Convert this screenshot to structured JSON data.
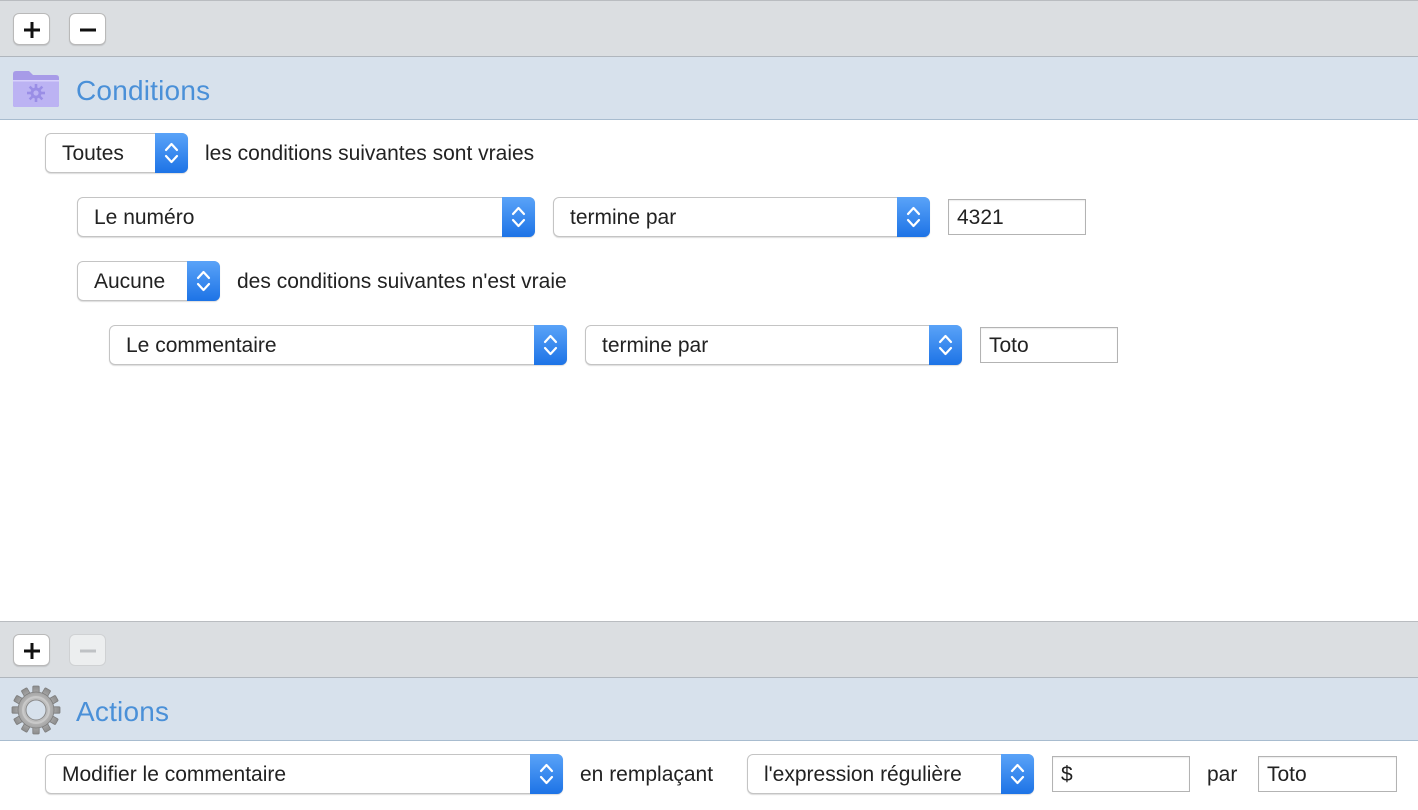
{
  "conditions": {
    "title": "Conditions",
    "match_popup": "Toutes",
    "match_text": "les conditions suivantes sont vraies",
    "rule1": {
      "field": "Le numéro",
      "operator": "termine par",
      "value": "4321"
    },
    "group": {
      "match_popup": "Aucune",
      "match_text": "des conditions suivantes n'est vraie",
      "rule": {
        "field": "Le commentaire",
        "operator": "termine par",
        "value": "Toto"
      }
    }
  },
  "actions": {
    "title": "Actions",
    "action_popup": "Modifier le commentaire",
    "replacing_text": "en remplaçant",
    "pattern_popup": "l'expression régulière",
    "pattern_value": "$",
    "by_text": "par",
    "replacement_value": "Toto"
  },
  "colors": {
    "accent": "#4a90d8",
    "header_bg": "#d7e1ec",
    "toolbar_bg": "#dbdee1",
    "stepper_top": "#5aa3f8",
    "stepper_bottom": "#1d73e6"
  },
  "icons": {
    "add": "plus-icon",
    "remove": "minus-icon",
    "conditions": "folder-gear-icon",
    "actions": "gear-icon",
    "popup": "chevron-up-down-icon"
  }
}
